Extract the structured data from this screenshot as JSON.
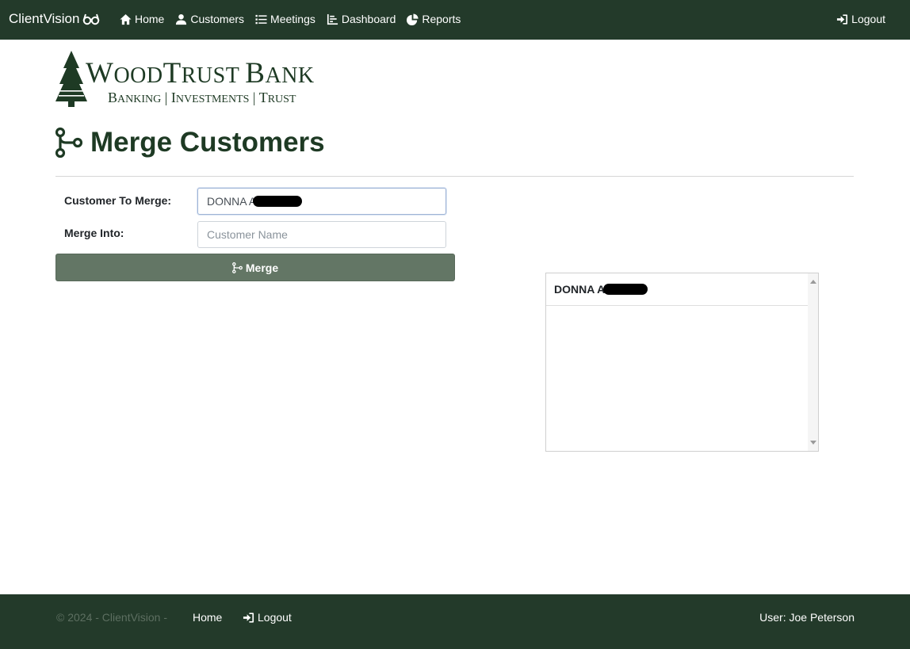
{
  "nav": {
    "brand": "ClientVision",
    "items": [
      {
        "label": "Home",
        "icon": "home-icon"
      },
      {
        "label": "Customers",
        "icon": "user-icon"
      },
      {
        "label": "Meetings",
        "icon": "list-icon"
      },
      {
        "label": "Dashboard",
        "icon": "chart-icon"
      },
      {
        "label": "Reports",
        "icon": "pie-icon"
      }
    ],
    "logout": "Logout"
  },
  "logo": {
    "title_parts": [
      "W",
      "OOD",
      "T",
      "RUST ",
      "B",
      "ANK"
    ],
    "sub_parts": [
      "B",
      "ANKING",
      " | ",
      "I",
      "NVESTMENTS",
      " | ",
      "T",
      "RUST"
    ]
  },
  "page": {
    "title": "Merge Customers"
  },
  "form": {
    "customer_to_merge_label": "Customer To Merge:",
    "customer_to_merge_value": "DONNA A",
    "merge_into_label": "Merge Into:",
    "merge_into_placeholder": "Customer Name",
    "merge_button": "Merge"
  },
  "results": {
    "items": [
      {
        "name": "DONNA A"
      }
    ]
  },
  "footer": {
    "copyright": "© 2024 - ClientVision -",
    "home": "Home",
    "logout": "Logout",
    "user": "User: Joe Peterson"
  },
  "colors": {
    "nav_bg": "#233a2a",
    "brand_green": "#1e3a24",
    "button_bg": "#637665"
  }
}
